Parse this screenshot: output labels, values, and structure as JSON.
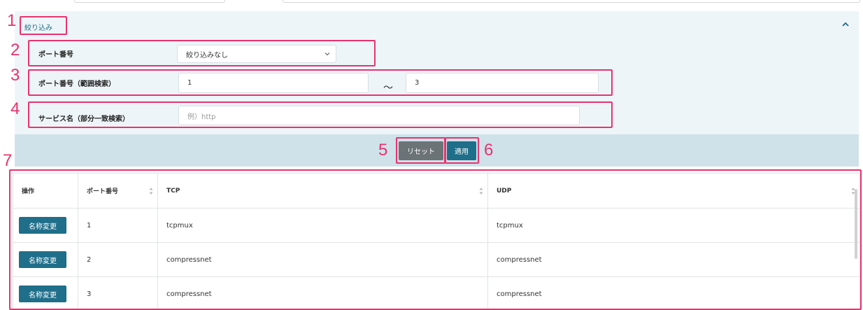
{
  "filter": {
    "title": "絞り込み",
    "port_label": "ポート番号",
    "port_select_value": "絞り込みなし",
    "range_label": "ポート番号（範囲検索）",
    "range_from": "1",
    "range_separator": "〜",
    "range_to": "3",
    "service_label": "サービス名（部分一致検索）",
    "service_placeholder": "例）http",
    "reset_label": "リセット",
    "apply_label": "適用"
  },
  "callouts": [
    "1",
    "2",
    "3",
    "4",
    "5",
    "6",
    "7"
  ],
  "table": {
    "columns": [
      "操作",
      "ポート番号",
      "TCP",
      "UDP"
    ],
    "rows": [
      {
        "action": "名称変更",
        "port": "1",
        "tcp": "tcpmux",
        "udp": "tcpmux"
      },
      {
        "action": "名称変更",
        "port": "2",
        "tcp": "compressnet",
        "udp": "compressnet"
      },
      {
        "action": "名称変更",
        "port": "3",
        "tcp": "compressnet",
        "udp": "compressnet"
      }
    ]
  },
  "colors": {
    "accent": "#1f6e8a",
    "callout": "#e8336e",
    "panel_bg": "#eef5f8",
    "action_bar_bg": "#cfe2ea",
    "reset_button": "#6c7377"
  },
  "icons": {
    "collapse": "chevron-up-icon",
    "select": "chevron-down-icon",
    "sort": "sort-icon"
  }
}
